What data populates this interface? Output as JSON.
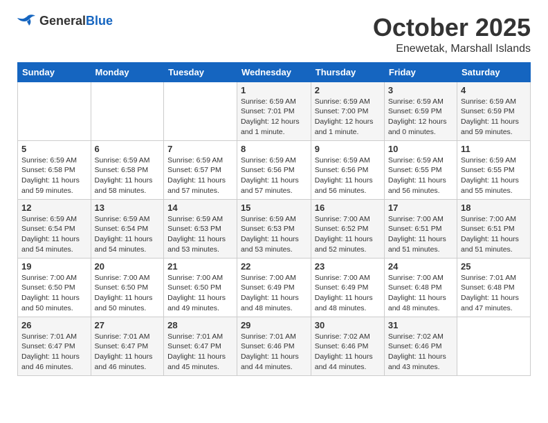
{
  "header": {
    "logo_general": "General",
    "logo_blue": "Blue",
    "month": "October 2025",
    "location": "Enewetak, Marshall Islands"
  },
  "weekdays": [
    "Sunday",
    "Monday",
    "Tuesday",
    "Wednesday",
    "Thursday",
    "Friday",
    "Saturday"
  ],
  "weeks": [
    [
      {
        "day": "",
        "info": ""
      },
      {
        "day": "",
        "info": ""
      },
      {
        "day": "",
        "info": ""
      },
      {
        "day": "1",
        "info": "Sunrise: 6:59 AM\nSunset: 7:01 PM\nDaylight: 12 hours\nand 1 minute."
      },
      {
        "day": "2",
        "info": "Sunrise: 6:59 AM\nSunset: 7:00 PM\nDaylight: 12 hours\nand 1 minute."
      },
      {
        "day": "3",
        "info": "Sunrise: 6:59 AM\nSunset: 6:59 PM\nDaylight: 12 hours\nand 0 minutes."
      },
      {
        "day": "4",
        "info": "Sunrise: 6:59 AM\nSunset: 6:59 PM\nDaylight: 11 hours\nand 59 minutes."
      }
    ],
    [
      {
        "day": "5",
        "info": "Sunrise: 6:59 AM\nSunset: 6:58 PM\nDaylight: 11 hours\nand 59 minutes."
      },
      {
        "day": "6",
        "info": "Sunrise: 6:59 AM\nSunset: 6:58 PM\nDaylight: 11 hours\nand 58 minutes."
      },
      {
        "day": "7",
        "info": "Sunrise: 6:59 AM\nSunset: 6:57 PM\nDaylight: 11 hours\nand 57 minutes."
      },
      {
        "day": "8",
        "info": "Sunrise: 6:59 AM\nSunset: 6:56 PM\nDaylight: 11 hours\nand 57 minutes."
      },
      {
        "day": "9",
        "info": "Sunrise: 6:59 AM\nSunset: 6:56 PM\nDaylight: 11 hours\nand 56 minutes."
      },
      {
        "day": "10",
        "info": "Sunrise: 6:59 AM\nSunset: 6:55 PM\nDaylight: 11 hours\nand 56 minutes."
      },
      {
        "day": "11",
        "info": "Sunrise: 6:59 AM\nSunset: 6:55 PM\nDaylight: 11 hours\nand 55 minutes."
      }
    ],
    [
      {
        "day": "12",
        "info": "Sunrise: 6:59 AM\nSunset: 6:54 PM\nDaylight: 11 hours\nand 54 minutes."
      },
      {
        "day": "13",
        "info": "Sunrise: 6:59 AM\nSunset: 6:54 PM\nDaylight: 11 hours\nand 54 minutes."
      },
      {
        "day": "14",
        "info": "Sunrise: 6:59 AM\nSunset: 6:53 PM\nDaylight: 11 hours\nand 53 minutes."
      },
      {
        "day": "15",
        "info": "Sunrise: 6:59 AM\nSunset: 6:53 PM\nDaylight: 11 hours\nand 53 minutes."
      },
      {
        "day": "16",
        "info": "Sunrise: 7:00 AM\nSunset: 6:52 PM\nDaylight: 11 hours\nand 52 minutes."
      },
      {
        "day": "17",
        "info": "Sunrise: 7:00 AM\nSunset: 6:51 PM\nDaylight: 11 hours\nand 51 minutes."
      },
      {
        "day": "18",
        "info": "Sunrise: 7:00 AM\nSunset: 6:51 PM\nDaylight: 11 hours\nand 51 minutes."
      }
    ],
    [
      {
        "day": "19",
        "info": "Sunrise: 7:00 AM\nSunset: 6:50 PM\nDaylight: 11 hours\nand 50 minutes."
      },
      {
        "day": "20",
        "info": "Sunrise: 7:00 AM\nSunset: 6:50 PM\nDaylight: 11 hours\nand 50 minutes."
      },
      {
        "day": "21",
        "info": "Sunrise: 7:00 AM\nSunset: 6:50 PM\nDaylight: 11 hours\nand 49 minutes."
      },
      {
        "day": "22",
        "info": "Sunrise: 7:00 AM\nSunset: 6:49 PM\nDaylight: 11 hours\nand 48 minutes."
      },
      {
        "day": "23",
        "info": "Sunrise: 7:00 AM\nSunset: 6:49 PM\nDaylight: 11 hours\nand 48 minutes."
      },
      {
        "day": "24",
        "info": "Sunrise: 7:00 AM\nSunset: 6:48 PM\nDaylight: 11 hours\nand 48 minutes."
      },
      {
        "day": "25",
        "info": "Sunrise: 7:01 AM\nSunset: 6:48 PM\nDaylight: 11 hours\nand 47 minutes."
      }
    ],
    [
      {
        "day": "26",
        "info": "Sunrise: 7:01 AM\nSunset: 6:47 PM\nDaylight: 11 hours\nand 46 minutes."
      },
      {
        "day": "27",
        "info": "Sunrise: 7:01 AM\nSunset: 6:47 PM\nDaylight: 11 hours\nand 46 minutes."
      },
      {
        "day": "28",
        "info": "Sunrise: 7:01 AM\nSunset: 6:47 PM\nDaylight: 11 hours\nand 45 minutes."
      },
      {
        "day": "29",
        "info": "Sunrise: 7:01 AM\nSunset: 6:46 PM\nDaylight: 11 hours\nand 44 minutes."
      },
      {
        "day": "30",
        "info": "Sunrise: 7:02 AM\nSunset: 6:46 PM\nDaylight: 11 hours\nand 44 minutes."
      },
      {
        "day": "31",
        "info": "Sunrise: 7:02 AM\nSunset: 6:46 PM\nDaylight: 11 hours\nand 43 minutes."
      },
      {
        "day": "",
        "info": ""
      }
    ]
  ]
}
